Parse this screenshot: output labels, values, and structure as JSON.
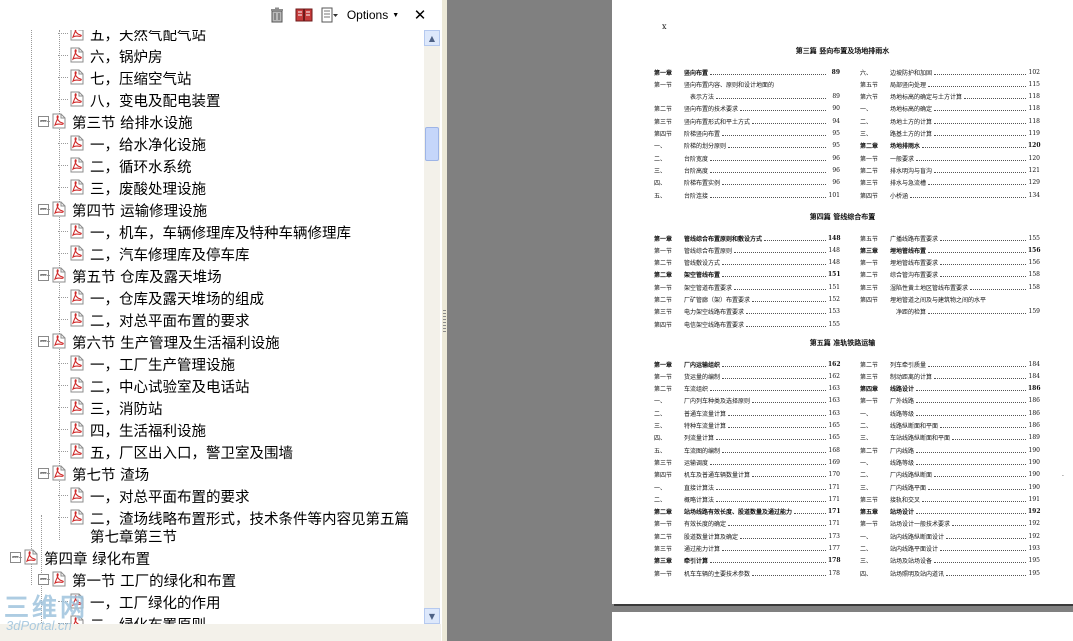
{
  "toolbar": {
    "options_label": "Options",
    "delete_icon": "trash-icon",
    "properties_icon": "book-icon",
    "close_icon": "close-icon"
  },
  "tree": [
    {
      "level": 3,
      "label": "五，天然气配气站"
    },
    {
      "level": 3,
      "label": "六，锅炉房"
    },
    {
      "level": 3,
      "label": "七，压缩空气站"
    },
    {
      "level": 3,
      "label": "八，变电及配电装置"
    },
    {
      "level": 2,
      "label": "第三节 给排水设施",
      "toggle": "−"
    },
    {
      "level": 3,
      "label": "一，给水净化设施"
    },
    {
      "level": 3,
      "label": "二，循环水系统"
    },
    {
      "level": 3,
      "label": "三，废酸处理设施"
    },
    {
      "level": 2,
      "label": "第四节 运输修理设施",
      "toggle": "−"
    },
    {
      "level": 3,
      "label": "一，机车，车辆修理库及特种车辆修理库"
    },
    {
      "level": 3,
      "label": "二，汽车修理库及停车库"
    },
    {
      "level": 2,
      "label": "第五节 仓库及露天堆场",
      "toggle": "−"
    },
    {
      "level": 3,
      "label": "一，仓库及露天堆场的组成"
    },
    {
      "level": 3,
      "label": "二，对总平面布置的要求"
    },
    {
      "level": 2,
      "label": "第六节 生产管理及生活福利设施",
      "toggle": "−"
    },
    {
      "level": 3,
      "label": "一，工厂生产管理设施"
    },
    {
      "level": 3,
      "label": "二，中心试验室及电话站"
    },
    {
      "level": 3,
      "label": "三，消防站"
    },
    {
      "level": 3,
      "label": "四，生活福利设施"
    },
    {
      "level": 3,
      "label": "五，厂区出入口，警卫室及围墙"
    },
    {
      "level": 2,
      "label": "第七节 渣场",
      "toggle": "−"
    },
    {
      "level": 3,
      "label": "一，对总平面布置的要求"
    },
    {
      "level": 3,
      "label": "二，渣场线略布置形式，技术条件等内容见第五篇",
      "cont": "第七章第三节"
    },
    {
      "level": 1,
      "label": "第四章 绿化布置",
      "toggle": "−"
    },
    {
      "level": 2,
      "label": "第一节 工厂的绿化和布置",
      "toggle": "−"
    },
    {
      "level": 3,
      "label": "一，工厂绿化的作用"
    },
    {
      "level": 3,
      "label": "二，绿化布置原则"
    }
  ],
  "watermark": {
    "line1": "三维网",
    "line2": "3dPortal.cn"
  },
  "document": {
    "page_mark": "x",
    "parts": [
      {
        "title": "第三篇  竖向布置及场地排雨水",
        "left": [
          {
            "num": "第一章",
            "title": "竖向布置",
            "page": "89",
            "bold": true
          },
          {
            "num": "第一节",
            "title": "竖向布置内容、原则和设计地面的",
            "page": ""
          },
          {
            "num": "",
            "title": "表示方法",
            "page": "89"
          },
          {
            "num": "第二节",
            "title": "竖向布置的技术要求",
            "page": "90"
          },
          {
            "num": "第三节",
            "title": "竖向布置形式和平土方式",
            "page": "94"
          },
          {
            "num": "第四节",
            "title": "阶梯竖向布置",
            "page": "95"
          },
          {
            "num": "一、",
            "title": "阶梯的划分原则",
            "page": "95"
          },
          {
            "num": "二、",
            "title": "台阶宽度",
            "page": "96"
          },
          {
            "num": "三、",
            "title": "台阶高度",
            "page": "96"
          },
          {
            "num": "四、",
            "title": "阶梯布置实例",
            "page": "96"
          },
          {
            "num": "五、",
            "title": "台阶连接",
            "page": "101"
          }
        ],
        "right": [
          {
            "num": "六、",
            "title": "边坡防护和加固",
            "page": "102"
          },
          {
            "num": "第五节",
            "title": "局部竖向处理",
            "page": "115"
          },
          {
            "num": "第六节",
            "title": "场地标高的确定与土方计算",
            "page": "118"
          },
          {
            "num": "一、",
            "title": "场地标高的确定",
            "page": "118"
          },
          {
            "num": "二、",
            "title": "场地土方的计算",
            "page": "118"
          },
          {
            "num": "三、",
            "title": "路基土方的计算",
            "page": "119"
          },
          {
            "num": "第二章",
            "title": "场地排雨水",
            "page": "120",
            "bold": true
          },
          {
            "num": "第一节",
            "title": "一般要求",
            "page": "120"
          },
          {
            "num": "第二节",
            "title": "排水明沟与盲沟",
            "page": "121"
          },
          {
            "num": "第三节",
            "title": "排水与急流槽",
            "page": "129"
          },
          {
            "num": "第四节",
            "title": "小桥涵",
            "page": "134"
          }
        ]
      },
      {
        "title": "第四篇  管线综合布置",
        "left": [
          {
            "num": "第一章",
            "title": "管线综合布置原则和敷设方式",
            "page": "148",
            "bold": true
          },
          {
            "num": "第一节",
            "title": "管线综合布置原则",
            "page": "148"
          },
          {
            "num": "第二节",
            "title": "管线敷设方式",
            "page": "148"
          },
          {
            "num": "第二章",
            "title": "架空管线布置",
            "page": "151",
            "bold": true
          },
          {
            "num": "第一节",
            "title": "架空管道布置要求",
            "page": "151"
          },
          {
            "num": "第二节",
            "title": "厂矿管廊（架）布置要求",
            "page": "152"
          },
          {
            "num": "第三节",
            "title": "电力架空线路布置要求",
            "page": "153"
          },
          {
            "num": "第四节",
            "title": "电信架空线路布置要求",
            "page": "155"
          }
        ],
        "right": [
          {
            "num": "第五节",
            "title": "广播线路布置要求",
            "page": "155"
          },
          {
            "num": "第三章",
            "title": "埋地管线布置",
            "page": "156",
            "bold": true
          },
          {
            "num": "第一节",
            "title": "埋地管线布置要求",
            "page": "156"
          },
          {
            "num": "第二节",
            "title": "综合管沟布置要求",
            "page": "158"
          },
          {
            "num": "第三节",
            "title": "湿陷性黄土地区管线布置要求",
            "page": "158"
          },
          {
            "num": "第四节",
            "title": "埋地管道之间及与建筑物之间的水平",
            "page": ""
          },
          {
            "num": "",
            "title": "净距的检算",
            "page": "159"
          }
        ]
      },
      {
        "title": "第五篇  准轨铁路运输",
        "left": [
          {
            "num": "第一章",
            "title": "厂内运输组织",
            "page": "162",
            "bold": true
          },
          {
            "num": "第一节",
            "title": "货运量的编制",
            "page": "162"
          },
          {
            "num": "第二节",
            "title": "车流组织",
            "page": "163"
          },
          {
            "num": "一、",
            "title": "厂内列车种类及选择原则",
            "page": "163"
          },
          {
            "num": "二、",
            "title": "普通车流量计算",
            "page": "163"
          },
          {
            "num": "三、",
            "title": "特种车流量计算",
            "page": "165"
          },
          {
            "num": "四、",
            "title": "列流量计算",
            "page": "165"
          },
          {
            "num": "五、",
            "title": "车流图的编制",
            "page": "168"
          },
          {
            "num": "第三节",
            "title": "运输调度",
            "page": "169"
          },
          {
            "num": "第四节",
            "title": "机车及普通车辆数量计算",
            "page": "170"
          },
          {
            "num": "一、",
            "title": "直接计算法",
            "page": "171"
          },
          {
            "num": "二、",
            "title": "概略计算法",
            "page": "171"
          },
          {
            "num": "第二章",
            "title": "站场线路有效长度、股道数量及通过能力",
            "page": "171",
            "bold": true
          },
          {
            "num": "第一节",
            "title": "有效长度的确定",
            "page": "171"
          },
          {
            "num": "第二节",
            "title": "股道数量计算及确定",
            "page": "173"
          },
          {
            "num": "第三节",
            "title": "通过能力计算",
            "page": "177"
          },
          {
            "num": "第三章",
            "title": "牵引计算",
            "page": "178",
            "bold": true
          },
          {
            "num": "第一节",
            "title": "机车车辆的主要技术参数",
            "page": "178"
          }
        ],
        "right": [
          {
            "num": "第二节",
            "title": "列车牵引质量",
            "page": "184"
          },
          {
            "num": "第三节",
            "title": "制动距离的计算",
            "page": "184"
          },
          {
            "num": "第四章",
            "title": "线路设计",
            "page": "186",
            "bold": true
          },
          {
            "num": "第一节",
            "title": "厂外线路",
            "page": "186"
          },
          {
            "num": "一、",
            "title": "线路等级",
            "page": "186"
          },
          {
            "num": "二、",
            "title": "线路纵断面和平面",
            "page": "186"
          },
          {
            "num": "三、",
            "title": "车站线路纵断面和平面",
            "page": "189"
          },
          {
            "num": "第二节",
            "title": "厂内线路",
            "page": "190"
          },
          {
            "num": "一、",
            "title": "线路等级",
            "page": "190"
          },
          {
            "num": "二、",
            "title": "厂内线路纵断面",
            "page": "190"
          },
          {
            "num": "三、",
            "title": "厂内线路平面",
            "page": "190"
          },
          {
            "num": "第三节",
            "title": "接轨和交叉",
            "page": "191"
          },
          {
            "num": "第五章",
            "title": "站场设计",
            "page": "192",
            "bold": true
          },
          {
            "num": "第一节",
            "title": "站场设计一般技术要求",
            "page": "192"
          },
          {
            "num": "一、",
            "title": "站内线路纵断面设计",
            "page": "192"
          },
          {
            "num": "二、",
            "title": "站内线路平面设计",
            "page": "193"
          },
          {
            "num": "三、",
            "title": "站场及站场设备",
            "page": "195"
          },
          {
            "num": "四、",
            "title": "站场照明及站内道讯",
            "page": "195"
          }
        ]
      }
    ]
  }
}
